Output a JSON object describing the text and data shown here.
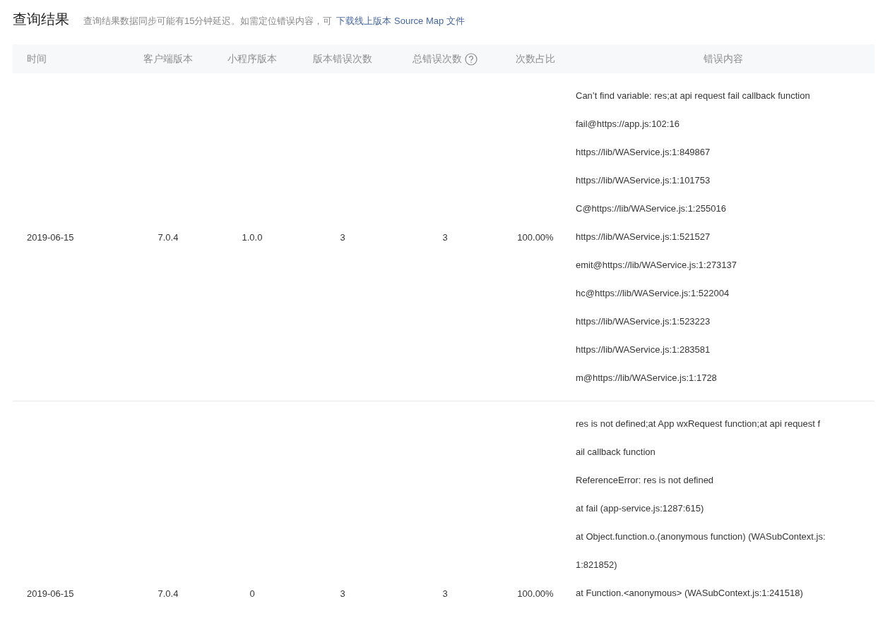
{
  "title": "查询结果",
  "notice": {
    "text": "查询结果数据同步可能有15分钟延迟。如需定位错误内容，可",
    "link": "下载线上版本 Source Map 文件"
  },
  "table": {
    "columns": [
      {
        "label": "时间"
      },
      {
        "label": "客户端版本"
      },
      {
        "label": "小程序版本"
      },
      {
        "label": "版本错误次数"
      },
      {
        "label": "总错误次数",
        "help_icon": true
      },
      {
        "label": "次数占比"
      },
      {
        "label": "错误内容"
      }
    ],
    "rows": [
      {
        "date": "2019-06-15",
        "client_version": "7.0.4",
        "app_version": "1.0.0",
        "version_errors": "3",
        "total_errors": "3",
        "ratio": "100.00%",
        "error_lines": [
          "Can’t find variable: res;at api request fail callback function",
          "fail@https://app.js:102:16",
          "https://lib/WAService.js:1:849867",
          "https://lib/WAService.js:1:101753",
          "C@https://lib/WAService.js:1:255016",
          "https://lib/WAService.js:1:521527",
          "emit@https://lib/WAService.js:1:273137",
          "hc@https://lib/WAService.js:1:522004",
          "https://lib/WAService.js:1:523223",
          "https://lib/WAService.js:1:283581",
          "m@https://lib/WAService.js:1:1728"
        ]
      },
      {
        "date": "2019-06-15",
        "client_version": "7.0.4",
        "app_version": "0",
        "version_errors": "3",
        "total_errors": "3",
        "ratio": "100.00%",
        "error_lines": [
          "res is not defined;at App wxRequest function;at api request f",
          "ail callback function",
          "ReferenceError: res is not defined",
          "at fail (app-service.js:1287:615)",
          "at Object.function.o.(anonymous function) (WASubContext.js:",
          "1:821852)",
          "at Function.<anonymous> (WASubContext.js:1:241518)"
        ]
      }
    ]
  }
}
